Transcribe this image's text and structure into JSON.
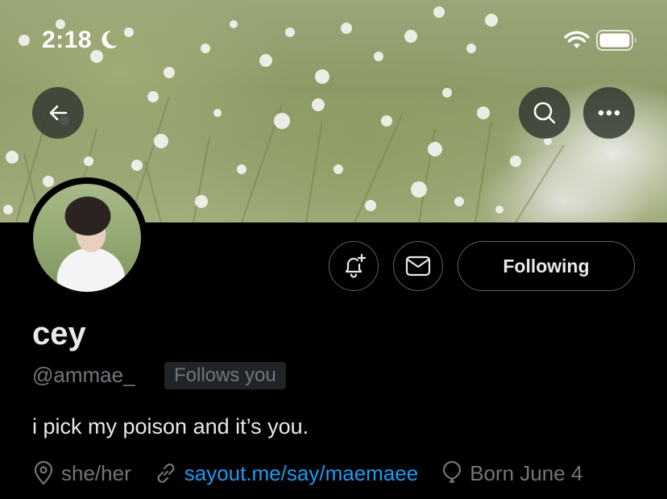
{
  "status_bar": {
    "time": "2:18"
  },
  "header": {
    "back_icon": "arrow-left-icon",
    "search_icon": "search-icon",
    "more_icon": "more-horizontal-icon"
  },
  "profile": {
    "name": "cey",
    "handle": "@ammae_",
    "follows_you": "Follows you",
    "bio": "i pick my poison and it’s you.",
    "pronouns": "she/her",
    "website": "sayout.me/say/maemaee",
    "birthday": "Born June 4"
  },
  "actions": {
    "following_label": "Following",
    "notify_icon": "bell-plus-icon",
    "message_icon": "mail-icon"
  },
  "colors": {
    "background": "#000000",
    "accent_link": "#1d9bf0",
    "secondary_text": "#71767b",
    "button_border": "#536471"
  }
}
